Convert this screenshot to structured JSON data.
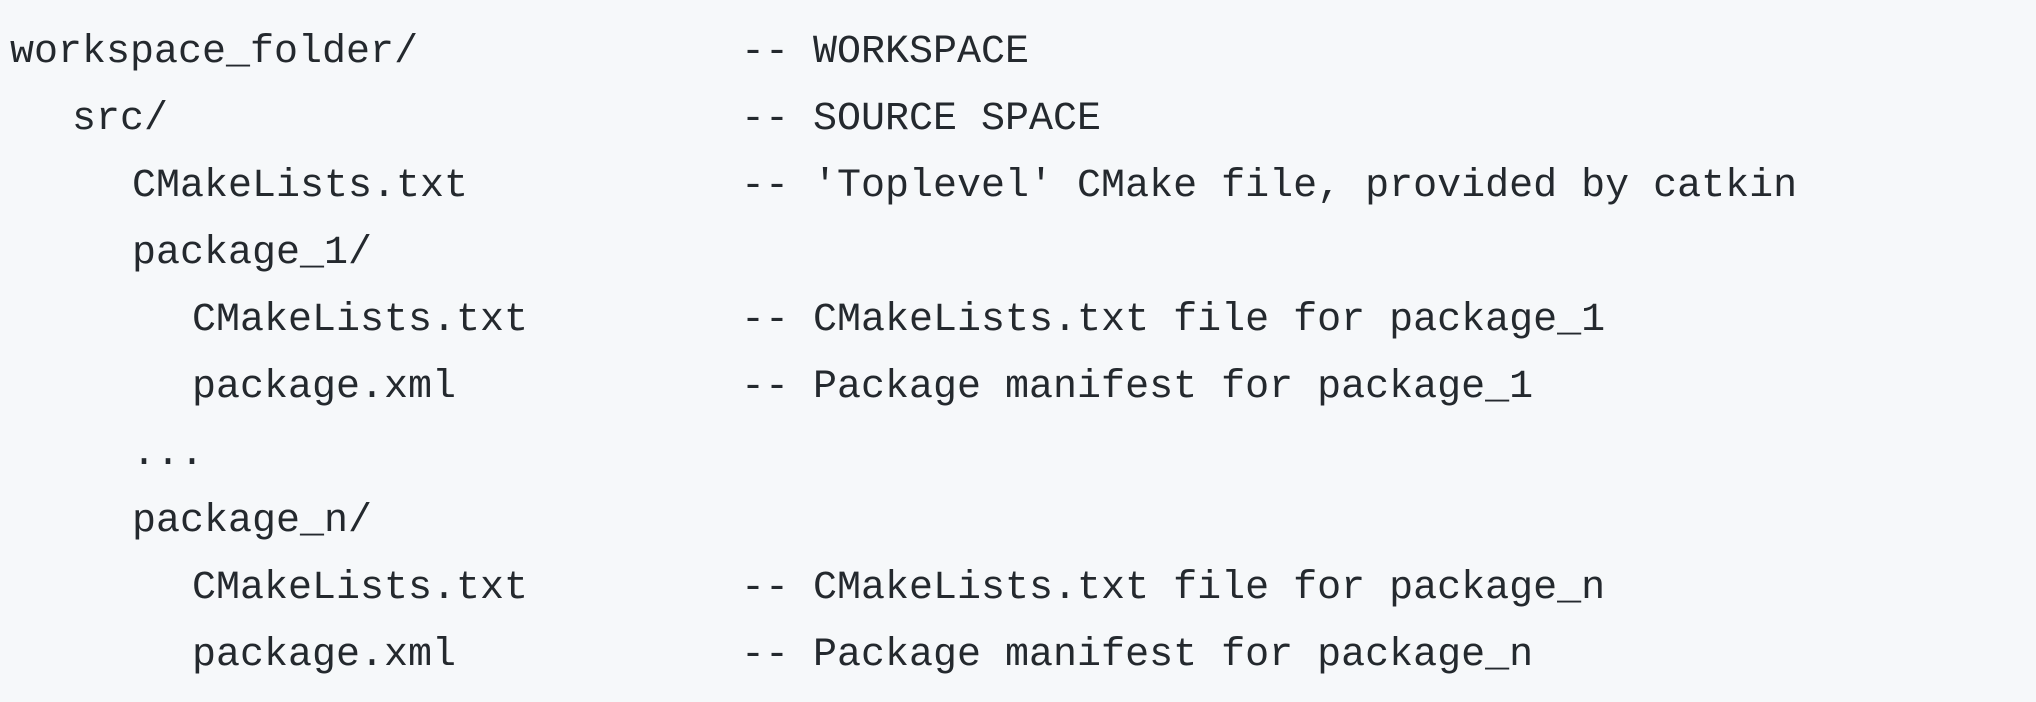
{
  "tree": [
    {
      "name": "workspace_folder/",
      "comment": "-- WORKSPACE",
      "indent": 0
    },
    {
      "name": "src/",
      "comment": "-- SOURCE SPACE",
      "indent": 1
    },
    {
      "name": "CMakeLists.txt",
      "comment": "-- 'Toplevel' CMake file, provided by catkin",
      "indent": 2
    },
    {
      "name": "package_1/",
      "comment": "",
      "indent": 2
    },
    {
      "name": "CMakeLists.txt",
      "comment": "-- CMakeLists.txt file for package_1",
      "indent": 3
    },
    {
      "name": "package.xml",
      "comment": "-- Package manifest for package_1",
      "indent": 3
    },
    {
      "name": "...",
      "comment": "",
      "indent": 2
    },
    {
      "name": "package_n/",
      "comment": "",
      "indent": 2
    },
    {
      "name": "CMakeLists.txt",
      "comment": "-- CMakeLists.txt file for package_n",
      "indent": 3
    },
    {
      "name": "package.xml",
      "comment": "-- Package manifest for package_n",
      "indent": 3
    }
  ]
}
